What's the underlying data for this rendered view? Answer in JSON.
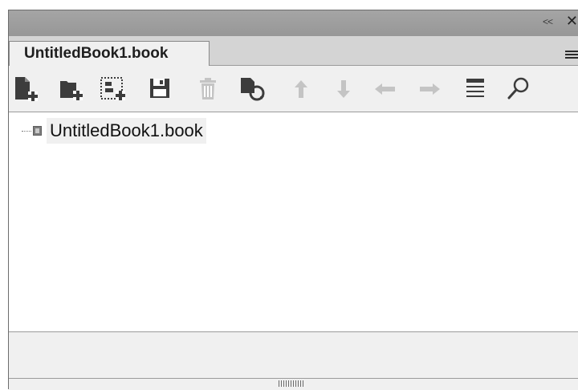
{
  "window": {
    "collapse_glyph": "<<",
    "close_glyph": "✕"
  },
  "tab": {
    "label": "UntitledBook1.book"
  },
  "toolbar": {
    "buttons": [
      {
        "name": "add-document-icon",
        "enabled": true
      },
      {
        "name": "add-folder-icon",
        "enabled": true
      },
      {
        "name": "add-selection-icon",
        "enabled": true
      },
      {
        "name": "save-icon",
        "enabled": true
      },
      {
        "name": "delete-icon",
        "enabled": false
      },
      {
        "name": "update-icon",
        "enabled": true
      },
      {
        "name": "move-up-icon",
        "enabled": false
      },
      {
        "name": "move-down-icon",
        "enabled": false
      },
      {
        "name": "move-left-icon",
        "enabled": false
      },
      {
        "name": "move-right-icon",
        "enabled": false
      },
      {
        "name": "properties-icon",
        "enabled": true
      },
      {
        "name": "search-icon",
        "enabled": true
      }
    ]
  },
  "tree": {
    "root_label": "UntitledBook1.book"
  },
  "colors": {
    "title_bar": "#a0a0a0",
    "panel_bg": "#f0f0f0",
    "icon_dark": "#3c3c3c",
    "icon_disabled": "#c4c4c4"
  }
}
